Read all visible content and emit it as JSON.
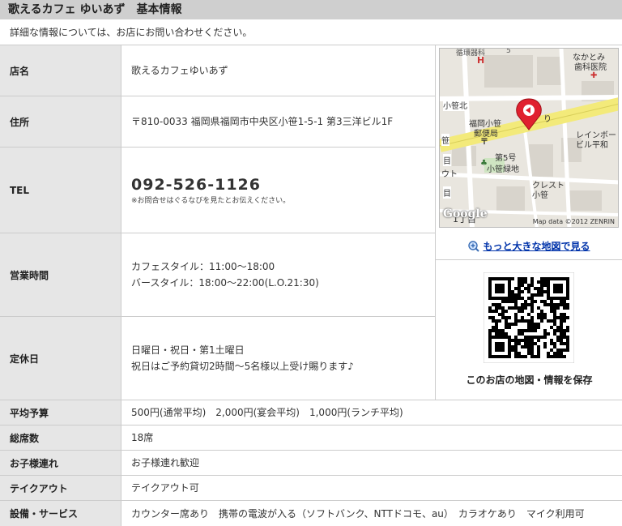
{
  "header": {
    "title": "歌えるカフェ ゆいあず　基本情報"
  },
  "intro": {
    "text": "詳細な情報については、お店にお問い合わせください。"
  },
  "info": {
    "name": {
      "label": "店名",
      "value": "歌えるカフェゆいあず"
    },
    "address": {
      "label": "住所",
      "value": "〒810-0033 福岡県福岡市中央区小笹1-5-1 第3三洋ビル1F"
    },
    "tel": {
      "label": "TEL",
      "number": "092-526-1126",
      "note": "※お問合せはぐるなびを見たとお伝えください。"
    },
    "hours": {
      "label": "営業時間",
      "lines": [
        "カフェスタイル：11:00～18:00",
        "バースタイル：18:00～22:00(L.O.21:30)"
      ]
    },
    "closed": {
      "label": "定休日",
      "lines": [
        "日曜日・祝日・第1土曜日",
        "祝日はご予約貸切2時間～5名様以上受け賜ります♪"
      ]
    }
  },
  "summary": {
    "budget": {
      "label": "平均予算",
      "value": "500円(通常平均)　2,000円(宴会平均)　1,000円(ランチ平均)"
    },
    "seats": {
      "label": "総席数",
      "value": "18席"
    },
    "kids": {
      "label": "お子様連れ",
      "value": "お子様連れ歓迎"
    },
    "takeout": {
      "label": "テイクアウト",
      "value": "テイクアウト可"
    },
    "facilities": {
      "label": "設備・サービス",
      "value": "カウンター席あり　携帯の電波が入る（ソフトバンク、NTTドコモ、au）　カラオケあり　マイク利用可"
    }
  },
  "map": {
    "labels": {
      "top_left": "循環器科",
      "top_num": "5",
      "hospital_top": "なかとみ",
      "hospital_bottom": "歯科医院",
      "kosasa_north": "小笹北",
      "post_office_1": "福岡小笹",
      "post_office_2": "郵便局",
      "road": "り",
      "plaza_1": "レインボー",
      "plaza_2": "ビル平和",
      "park_1": "第5号",
      "park_2": "小笹緑地",
      "crest_1": "クレスト",
      "crest_2": "小笹",
      "left_1": "笹",
      "left_2": "ウト",
      "left_3": "目",
      "left_4": "目",
      "chome": "1丁目",
      "logo": "Google",
      "credit": "Map data ©2012 ZENRIN"
    },
    "link_label": "もっと大きな地図で見る",
    "icons": {
      "zoom": "zoom-in-icon",
      "marker": "map-marker-icon"
    },
    "colors": {
      "road": "#f3ea7a",
      "marker": "#e0202f"
    }
  },
  "qr": {
    "caption": "このお店の地図・情報を保存"
  }
}
